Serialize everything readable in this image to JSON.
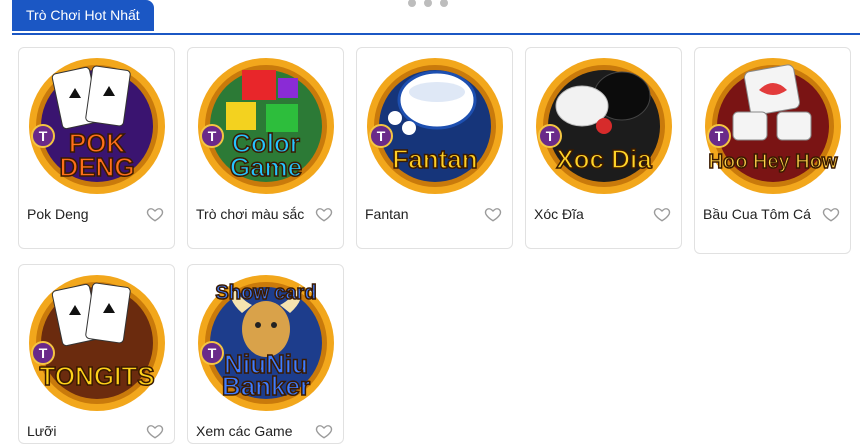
{
  "section": {
    "tab_label": "Trò Chơi Hot Nhất"
  },
  "games": [
    {
      "name": "Pok Deng",
      "logo_text": [
        "POK",
        "DENG"
      ],
      "logo_color": "#ff6f1a",
      "bg": "#3a1470",
      "icon": "cards"
    },
    {
      "name": "Trò chơi màu sắc",
      "logo_text": [
        "Color",
        "Game"
      ],
      "logo_color": "#25c4ff",
      "bg": "#2c7a36",
      "icon": "cubes"
    },
    {
      "name": "Fantan",
      "logo_text": [
        "Fantan"
      ],
      "logo_color": "#ffcf24",
      "bg": "#16357a",
      "icon": "bowl"
    },
    {
      "name": "Xóc Đĩa",
      "logo_text": [
        "Xoc Dia"
      ],
      "logo_color": "#ffd428",
      "bg": "#1c1c1c",
      "icon": "plate"
    },
    {
      "name": "Bầu Cua Tôm Cá",
      "logo_text": [
        "Hoo Hey How"
      ],
      "logo_color": "#ffd24a",
      "bg": "#7a1414",
      "icon": "dice"
    },
    {
      "name": "Lưỡi",
      "logo_text": [
        "TONGITS"
      ],
      "logo_color": "#ffd21a",
      "bg": "#6b2b0e",
      "icon": "aces"
    },
    {
      "name": "Xem các Game",
      "logo_text": [
        "Show card",
        "NiuNiu",
        "Banker"
      ],
      "logo_color": "#3e7cff",
      "bg": "#1d3d8c",
      "icon": "bull"
    }
  ],
  "brand_badge": "T"
}
